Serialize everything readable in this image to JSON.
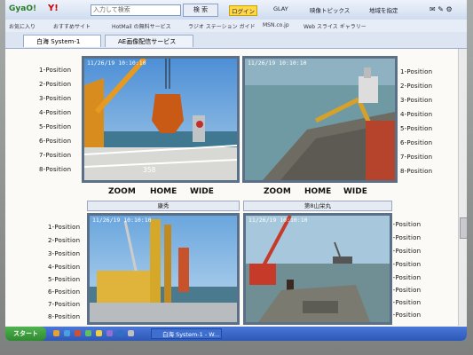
{
  "toolbar": {
    "logo": "GyaO!",
    "yahoo": "Y!",
    "search_placeholder": "入力して検索",
    "search_button": "検 索",
    "items": [
      "ログイン",
      "GLAY",
      "映像トピックス",
      "地域を指定"
    ]
  },
  "favorites": {
    "items": [
      "お気に入り",
      "おすすめサイト",
      "HotMail の無料サービス",
      "ラジオ ステーション ガイド",
      "MSN.co.jp",
      "Web スライス ギャラリー"
    ]
  },
  "tabs": [
    {
      "label": "白海 System-1"
    },
    {
      "label": "AE画像配信サービス"
    }
  ],
  "position_labels": [
    "1-Position",
    "2-Position",
    "3-Position",
    "4-Position",
    "5-Position",
    "6-Position",
    "7-Position",
    "8-Position"
  ],
  "cameras": [
    {
      "timestamp": "11/26/19 10:10:10",
      "header": ""
    },
    {
      "timestamp": "11/26/19 10:10:10",
      "header": ""
    },
    {
      "timestamp": "11/26/19 10:10:10",
      "header": "康秀"
    },
    {
      "timestamp": "11/26/19 10:10:10",
      "header": "第8山栄丸"
    }
  ],
  "controls": {
    "zoom": "ZOOM",
    "home": "HOME",
    "wide": "WIDE"
  },
  "overlay_number": "358",
  "taskbar": {
    "start": "スタート",
    "task": "白海 System-1 - W..."
  }
}
